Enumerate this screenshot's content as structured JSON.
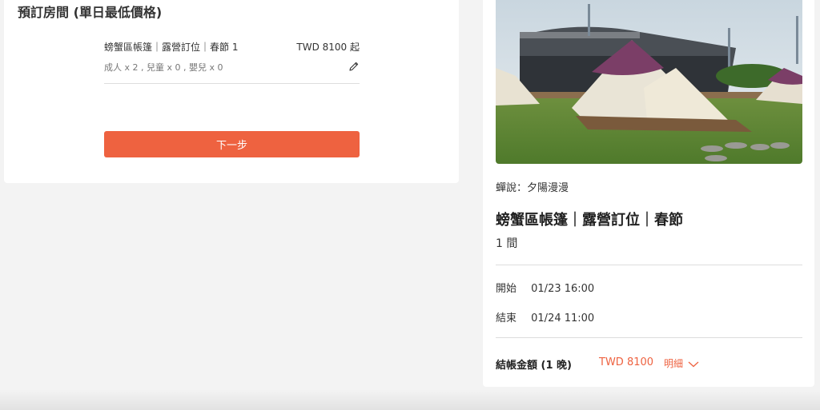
{
  "booking": {
    "section_title": "預訂房間 (單日最低價格)",
    "room_name": "螃蟹區帳篷｜露營訂位｜春節 1",
    "room_price": "TWD 8100 起",
    "guests": "成人 x 2 , 兒童 x 0 , 嬰兒 x 0",
    "edit_icon": "pencil-icon",
    "next_button": "下一步"
  },
  "summary": {
    "photo": "campsite-tents-photo",
    "camp_name": "蟬說：夕陽漫漫",
    "product_title": "螃蟹區帳篷｜露營訂位｜春節",
    "room_count": "1 間",
    "start_label": "開始",
    "start_value": "01/23 16:00",
    "end_label": "結束",
    "end_value": "01/24 11:00",
    "total_label": "結帳金額 (1 晚)",
    "total_amount": "TWD 8100",
    "detail_label": "明細",
    "detail_icon": "chevron-down-icon"
  },
  "colors": {
    "accent": "#ee6240",
    "background": "#f3f3f3"
  }
}
